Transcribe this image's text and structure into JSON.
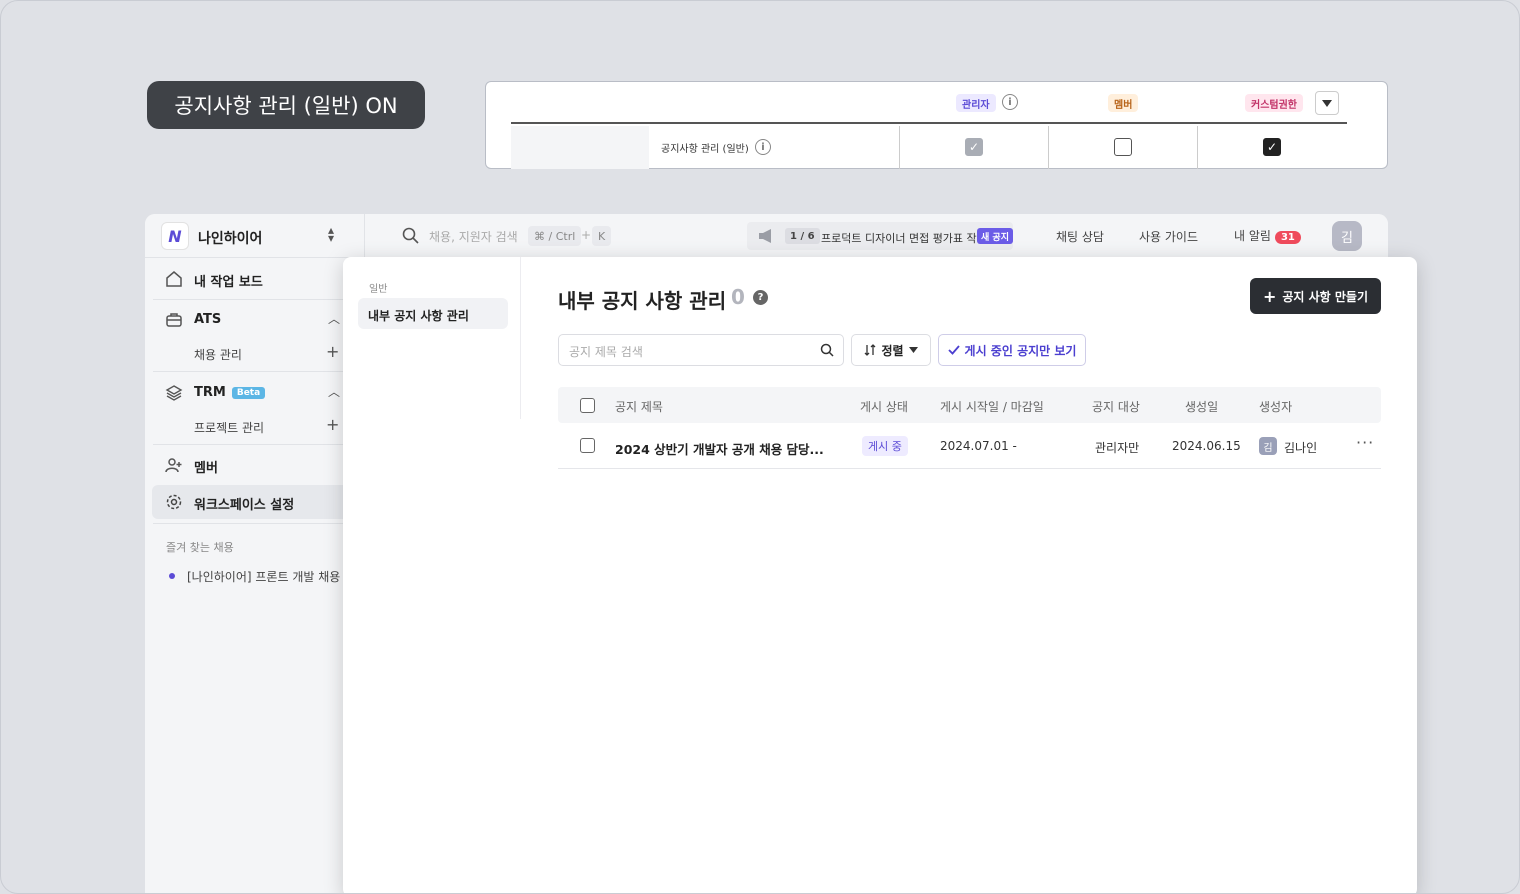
{
  "permission_pill": {
    "label": "공지사항 관리 (일반) ON"
  },
  "permission_card": {
    "roles": [
      {
        "label": "관리자",
        "color": "#5b4bd6"
      },
      {
        "label": "멤버",
        "color": "#b8641a"
      },
      {
        "label": "커스텀권한",
        "color": "#c23368"
      }
    ],
    "row_label": "공지사항 관리 (일반)",
    "dropdown_icon": "triangle-down",
    "checks": {
      "admin": true,
      "member": false,
      "custom": true
    }
  },
  "sidebar": {
    "workspace_name": "나인하이어",
    "items": [
      {
        "label": "내 작업 보드"
      },
      {
        "label": "ATS",
        "sub": "채용 관리"
      },
      {
        "label": "TRM",
        "badge": "Beta",
        "sub": "프로젝트 관리"
      },
      {
        "label": "멤버"
      },
      {
        "label": "워크스페이스 설정"
      }
    ],
    "favorites_title": "즐겨 찾는 채용",
    "favorite_item": "[나인하이어] 프론트 개발 채용"
  },
  "topbar": {
    "search_placeholder": "채용, 지원자 검색",
    "shortcut": "⌘ / Ctrl",
    "shortcut_plus": "+",
    "shortcut_key": "K",
    "notice_count": "1 / 6",
    "notice_text": "프로덕트 디자이너 면접 평가표 작...",
    "notice_badge": "새 공지",
    "links": {
      "chat": "채팅 상담",
      "guide": "사용 가이드",
      "alerts": "내 알림"
    },
    "alert_count": "31",
    "avatar_initial": "김"
  },
  "panel": {
    "subnav_category": "일반",
    "subnav_active": "내부 공지 사항 관리",
    "title": "내부 공지 사항 관리",
    "count": "0",
    "create_button": "공지 사항 만들기",
    "search_placeholder": "공지 제목 검색",
    "sort_label": "정렬",
    "filter_label": "게시 중인 공지만 보기",
    "table": {
      "headers": [
        "공지 제목",
        "게시 상태",
        "게시 시작일 / 마감일",
        "공지 대상",
        "생성일",
        "생성자"
      ],
      "rows": [
        {
          "title": "2024 상반기 개발자 공개 채용 담당...",
          "status": "게시 중",
          "period": "2024.07.01 -",
          "target": "관리자만",
          "created": "2024.06.15",
          "creator_initial": "김",
          "creator": "김나인"
        }
      ]
    }
  }
}
